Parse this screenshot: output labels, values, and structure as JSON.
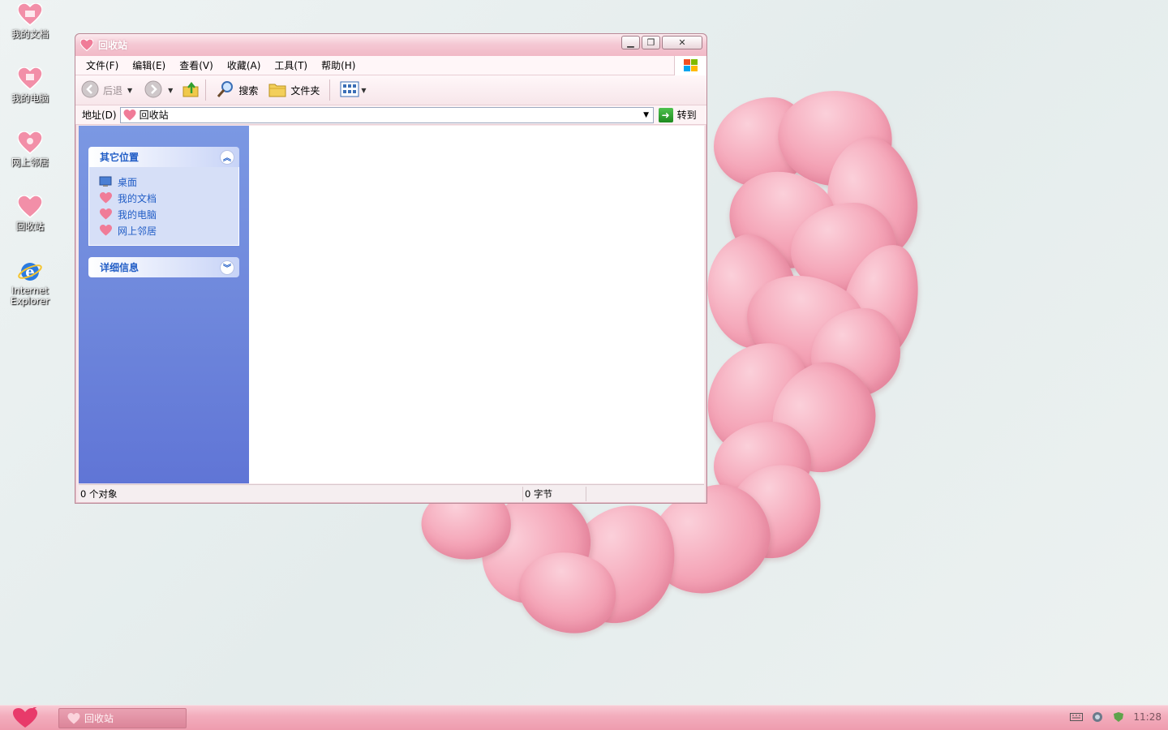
{
  "desktop": {
    "icons": [
      {
        "label": "我的文档",
        "icon": "heart-envelope-icon"
      },
      {
        "label": "我的电脑",
        "icon": "heart-computer-icon"
      },
      {
        "label": "网上邻居",
        "icon": "heart-network-icon"
      },
      {
        "label": "回收站",
        "icon": "heart-recycle-icon"
      },
      {
        "label": "Internet Explorer",
        "icon": "ie-icon"
      }
    ]
  },
  "window": {
    "title": "回收站",
    "menu": [
      "文件(F)",
      "编辑(E)",
      "查看(V)",
      "收藏(A)",
      "工具(T)",
      "帮助(H)"
    ],
    "toolbar": {
      "back": "后退",
      "search": "搜索",
      "folders": "文件夹"
    },
    "address": {
      "label": "地址(D)",
      "value": "回收站",
      "go": "转到"
    },
    "taskpane": {
      "other_places": {
        "title": "其它位置",
        "links": [
          "桌面",
          "我的文档",
          "我的电脑",
          "网上邻居"
        ]
      },
      "details": {
        "title": "详细信息"
      }
    },
    "status": {
      "objects": "0 个对象",
      "size": "0 字节"
    }
  },
  "taskbar": {
    "task_label": "回收站",
    "clock": "11:28"
  },
  "colors": {
    "title_pink": "#f1b8c6",
    "taskpane_blue": "#6f88dc",
    "link_blue": "#215dc6",
    "taskbar_pink": "#ee9cae"
  }
}
